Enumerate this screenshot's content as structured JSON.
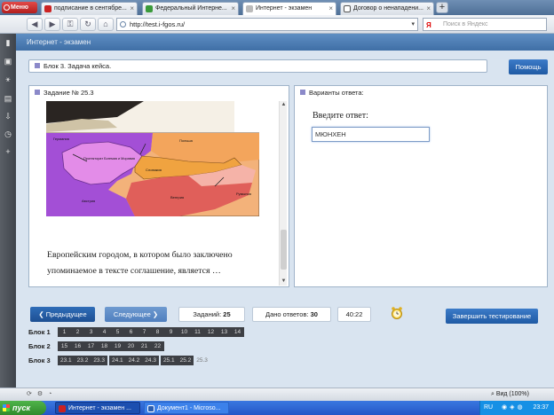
{
  "browser": {
    "menu_label": "Меню",
    "tabs": [
      {
        "label": "подписание в сентябре..."
      },
      {
        "label": "Федеральный Интерне..."
      },
      {
        "label": "Интернет - экзамен"
      },
      {
        "label": "Договор о ненападени..."
      }
    ],
    "new_tab": "+",
    "url": "http://test.i-fgos.ru/",
    "search_placeholder": "Поиск в Яндекс",
    "search_engine_letter": "Я"
  },
  "page": {
    "header_title": "Интернет - экзамен",
    "block_title": "Блок 3. Задача кейса.",
    "help_label": "Помощь",
    "task_title": "Задание № 25.3",
    "task_text": "Европейским городом, в котором было заключено упоминаемое в тексте соглашение, является …",
    "variants_title": "Варианты ответа:",
    "answer_prompt": "Введите ответ:",
    "answer_value": "МЮНХЕН"
  },
  "map": {
    "labels": {
      "germany": "Германия",
      "protectorate": "Протекторат Богемия и Моравия",
      "poland": "Польша",
      "slovakia": "Словакия",
      "austria": "Австрия",
      "hungary": "Венгрия",
      "romania": "Румыния"
    },
    "colors": {
      "germany": "#a34fd6",
      "protectorate": "#e38ce8",
      "poland_annex": "#f3a55c",
      "slovakia": "#f0a340",
      "hungary": "#e05f5a",
      "hungary_gain": "#f5b3a8",
      "background": "#f3b27a"
    }
  },
  "controls": {
    "prev_label": "Предыдущее",
    "next_label": "Следующее",
    "tasks_label": "Заданий:",
    "tasks_count": "25",
    "answered_label": "Дано ответов:",
    "answered_count": "30",
    "timer": "40:22",
    "finish_label": "Завершить тестирование"
  },
  "blocks": [
    {
      "label": "Блок 1",
      "items": [
        {
          "t": "1",
          "s": 0
        },
        {
          "t": "2",
          "s": 0
        },
        {
          "t": "3",
          "s": 0
        },
        {
          "t": "4",
          "s": 0
        },
        {
          "t": "5",
          "s": 0
        },
        {
          "t": "6",
          "s": 0
        },
        {
          "t": "7",
          "s": 0
        },
        {
          "t": "8",
          "s": 0
        },
        {
          "t": "9",
          "s": 0
        },
        {
          "t": "10",
          "s": 0
        },
        {
          "t": "11",
          "s": 0
        },
        {
          "t": "12",
          "s": 0
        },
        {
          "t": "13",
          "s": 0
        },
        {
          "t": "14",
          "s": 0
        }
      ]
    },
    {
      "label": "Блок 2",
      "items": [
        {
          "t": "15",
          "s": 0
        },
        {
          "t": "16",
          "s": 0
        },
        {
          "t": "17",
          "s": 0
        },
        {
          "t": "18",
          "s": 0
        },
        {
          "t": "19",
          "s": 0
        },
        {
          "t": "20",
          "s": 0
        },
        {
          "t": "21",
          "s": 0
        },
        {
          "t": "22",
          "s": 0
        }
      ]
    },
    {
      "label": "Блок 3",
      "items": [
        {
          "t": "23.1",
          "s": 0
        },
        {
          "t": "23.2",
          "s": 0
        },
        {
          "t": "23.3",
          "s": 0
        },
        {
          "t": "24.1",
          "s": 1
        },
        {
          "t": "24.2",
          "s": 0
        },
        {
          "t": "24.3",
          "s": 0
        },
        {
          "t": "25.1",
          "s": 1
        },
        {
          "t": "25.2",
          "s": 0
        },
        {
          "t": "25.3",
          "s": 0,
          "current": true
        }
      ]
    }
  ],
  "statusbar": {
    "zoom": "Вид (100%)"
  },
  "taskbar": {
    "start_label": "пуск",
    "tasks": [
      {
        "label": "Интернет - экзамен ..."
      },
      {
        "label": "Документ1 - Microso..."
      }
    ],
    "lang": "RU",
    "clock": "23:37"
  },
  "theme": {
    "accent": "#1f5aa4",
    "header": "#4f7fb6",
    "chip": "#3d3f44"
  }
}
